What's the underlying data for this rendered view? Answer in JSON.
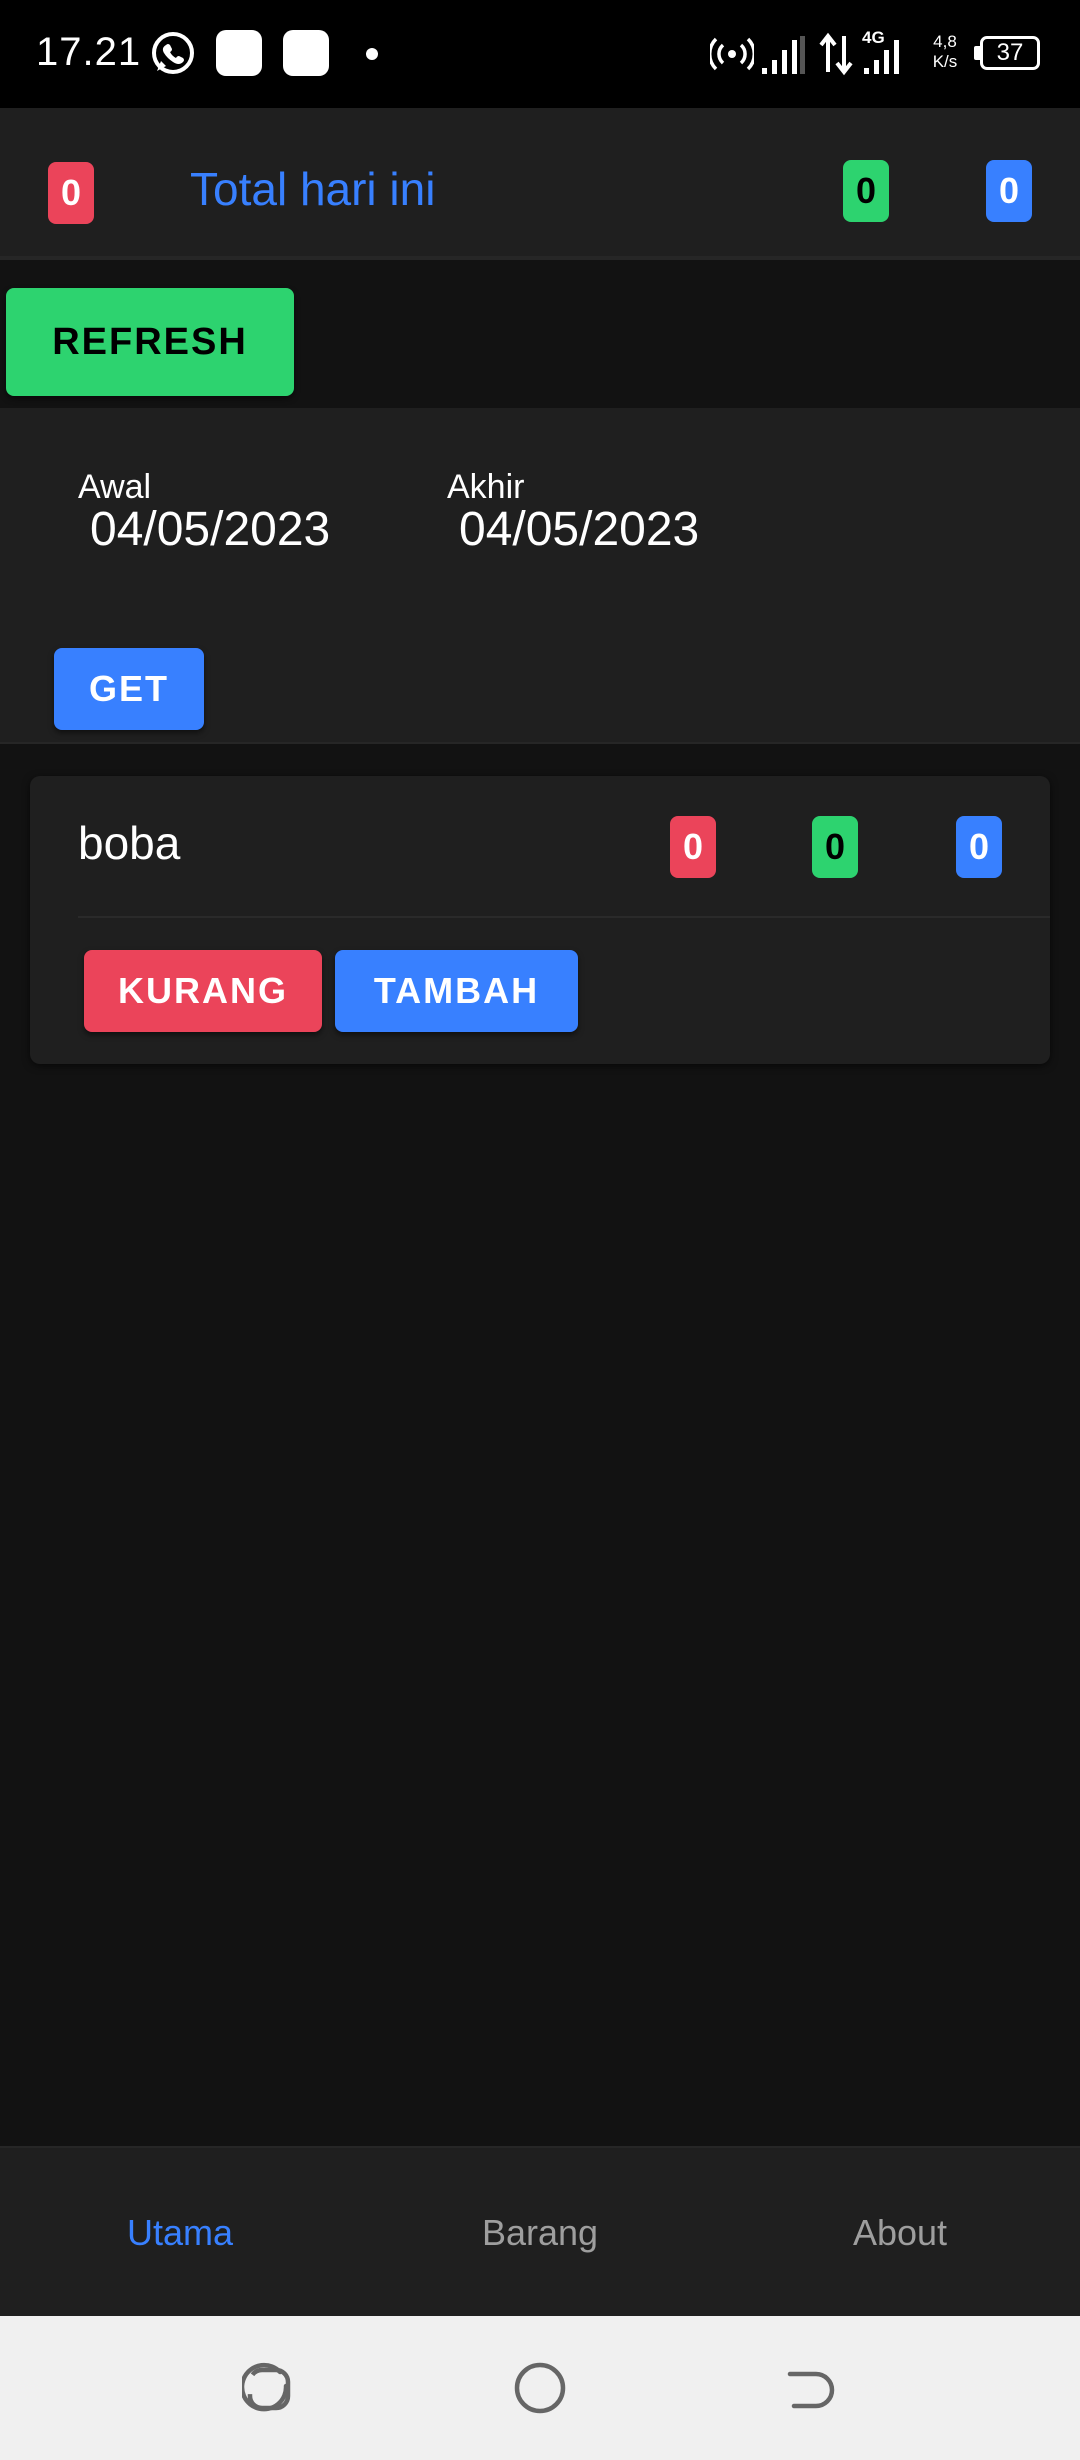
{
  "status_bar": {
    "time": "17.21",
    "network_type": "4G",
    "speed_value": "4,8",
    "speed_unit": "K/s",
    "battery": "37"
  },
  "header": {
    "title": "Total hari ini",
    "count_red": "0",
    "count_green": "0",
    "count_blue": "0"
  },
  "refresh_label": "REFRESH",
  "date_filter": {
    "start_label": "Awal",
    "start_value": "04/05/2023",
    "end_label": "Akhir",
    "end_value": "04/05/2023",
    "get_label": "GET"
  },
  "items": [
    {
      "name": "boba",
      "count_red": "0",
      "count_green": "0",
      "count_blue": "0",
      "decrease_label": "KURANG",
      "increase_label": "TAMBAH"
    }
  ],
  "tabs": [
    {
      "label": "Utama",
      "active": true
    },
    {
      "label": "Barang",
      "active": false
    },
    {
      "label": "About",
      "active": false
    }
  ],
  "colors": {
    "red": "#eb445a",
    "green": "#2dd36f",
    "blue": "#3880ff",
    "background": "#121212",
    "card": "#1f1f1f"
  }
}
